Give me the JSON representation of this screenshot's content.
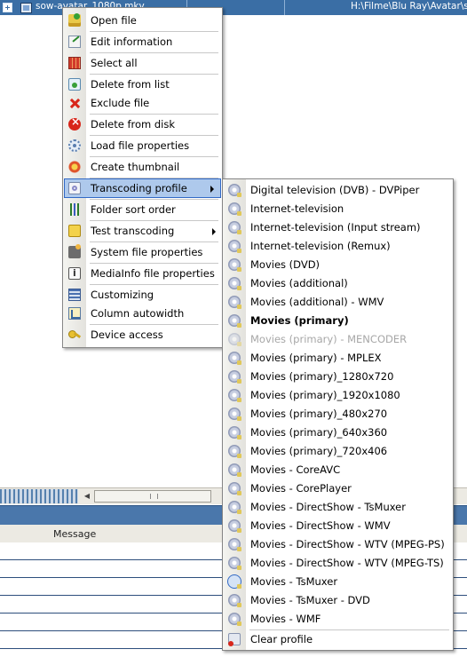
{
  "top_row": {
    "filename": "sow-avatar_1080p.mkv",
    "path": "H:\\Filme\\Blu Ray\\Avatar\\so"
  },
  "context_menu": {
    "items": [
      {
        "label": "Open file",
        "icon": "open-file-icon"
      },
      {
        "label": "Edit information",
        "icon": "edit-icon"
      },
      {
        "label": "Select all",
        "icon": "select-all-icon"
      },
      {
        "label": "Delete from list",
        "icon": "delete-from-list-icon"
      },
      {
        "label": "Exclude file",
        "icon": "exclude-icon"
      },
      {
        "label": "Delete from disk",
        "icon": "delete-disk-icon"
      },
      {
        "label": "Load file properties",
        "icon": "gear-icon"
      },
      {
        "label": "Create thumbnail",
        "icon": "thumbnail-icon"
      },
      {
        "label": "Transcoding profile",
        "icon": "transcoding-icon"
      },
      {
        "label": "Folder sort order",
        "icon": "sort-icon"
      },
      {
        "label": "Test transcoding",
        "icon": "test-icon"
      },
      {
        "label": "System file properties",
        "icon": "system-properties-icon"
      },
      {
        "label": "MediaInfo file properties",
        "icon": "mediainfo-icon"
      },
      {
        "label": "Customizing",
        "icon": "customize-icon"
      },
      {
        "label": "Column autowidth",
        "icon": "column-width-icon"
      },
      {
        "label": "Device access",
        "icon": "key-icon"
      }
    ]
  },
  "submenu": {
    "items": [
      {
        "label": "Digital television (DVB) - DVPiper"
      },
      {
        "label": "Internet-television"
      },
      {
        "label": "Internet-television (Input stream)"
      },
      {
        "label": "Internet-television (Remux)"
      },
      {
        "label": "Movies (DVD)"
      },
      {
        "label": "Movies (additional)"
      },
      {
        "label": "Movies (additional) - WMV"
      },
      {
        "label": "Movies (primary)"
      },
      {
        "label": "Movies (primary) - MENCODER"
      },
      {
        "label": "Movies (primary) - MPLEX"
      },
      {
        "label": "Movies (primary)_1280x720"
      },
      {
        "label": "Movies (primary)_1920x1080"
      },
      {
        "label": "Movies (primary)_480x270"
      },
      {
        "label": "Movies (primary)_640x360"
      },
      {
        "label": "Movies (primary)_720x406"
      },
      {
        "label": "Movies - CoreAVC"
      },
      {
        "label": "Movies - CorePlayer"
      },
      {
        "label": "Movies - DirectShow - TsMuxer"
      },
      {
        "label": "Movies - DirectShow - WMV"
      },
      {
        "label": "Movies - DirectShow - WTV (MPEG-PS)"
      },
      {
        "label": "Movies - DirectShow - WTV (MPEG-TS)"
      },
      {
        "label": "Movies - TsMuxer"
      },
      {
        "label": "Movies - TsMuxer - DVD"
      },
      {
        "label": "Movies - WMF"
      },
      {
        "label": "Clear profile"
      }
    ]
  },
  "bottom_panel": {
    "column_message": "Message"
  }
}
